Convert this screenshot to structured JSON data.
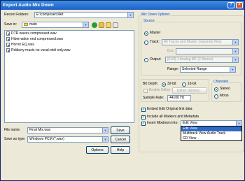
{
  "window": {
    "title": "Export Audio Mix Down",
    "help_glyph": "?",
    "close_glyph": "×"
  },
  "recent_folders": {
    "label": "Recent Folders:",
    "value": "E:\\composers\\Art"
  },
  "save_in": {
    "label": "Save in:",
    "value": "main"
  },
  "files": [
    "DTR waves compressed.wav",
    "Hibernation end compressed.wav",
    "Horror EQ.wav",
    "Robbery music-no vocal.midi only.wav"
  ],
  "file_name": {
    "label": "File name:",
    "value": "Final Mix.wav"
  },
  "save_as_type": {
    "label": "Save as type:",
    "value": "Windows PCM (*.wav)"
  },
  "buttons": {
    "save": "Save",
    "cancel": "Cancel",
    "options": "Options",
    "help": "Help"
  },
  "mixdown_options": {
    "title": "Mix Down Options",
    "source": {
      "title": "Source",
      "master": "Master",
      "track": "Track:",
      "track_value": "All Tracks and Master (separate files)",
      "bus": "Bus:",
      "output": "Output:",
      "output_value": "[01/0] 1 Analog MF (2 Stereo)",
      "range_label": "Range:",
      "range_value": "Selected Range"
    },
    "bit_depth": {
      "label": "Bit Depth:",
      "opt_32": "32-bit",
      "opt_16": "16-bit",
      "enable_dither": "Enable Dither",
      "dither_options": "Dither Options...",
      "sample_rate_label": "Sample Rate:",
      "sample_rate_value": "44100 Hz"
    },
    "channels": {
      "title": "Channels",
      "stereo": "Stereo",
      "mono": "Mono"
    },
    "embed_edit_link": "Embed Edit Original link data",
    "include_markers": "Include all Markers and Metadata",
    "insert_mixdown_label": "Insert Mixdown Into:",
    "insert_mixdown_value": "Edit View",
    "insert_options": [
      "Edit View",
      "Multitrack View Audio Track",
      "CD View"
    ]
  },
  "colors": {
    "title_bar": "#1d5fc8",
    "panel": "#ece9d8",
    "selection": "#316ac5",
    "check_green": "#21a121"
  }
}
